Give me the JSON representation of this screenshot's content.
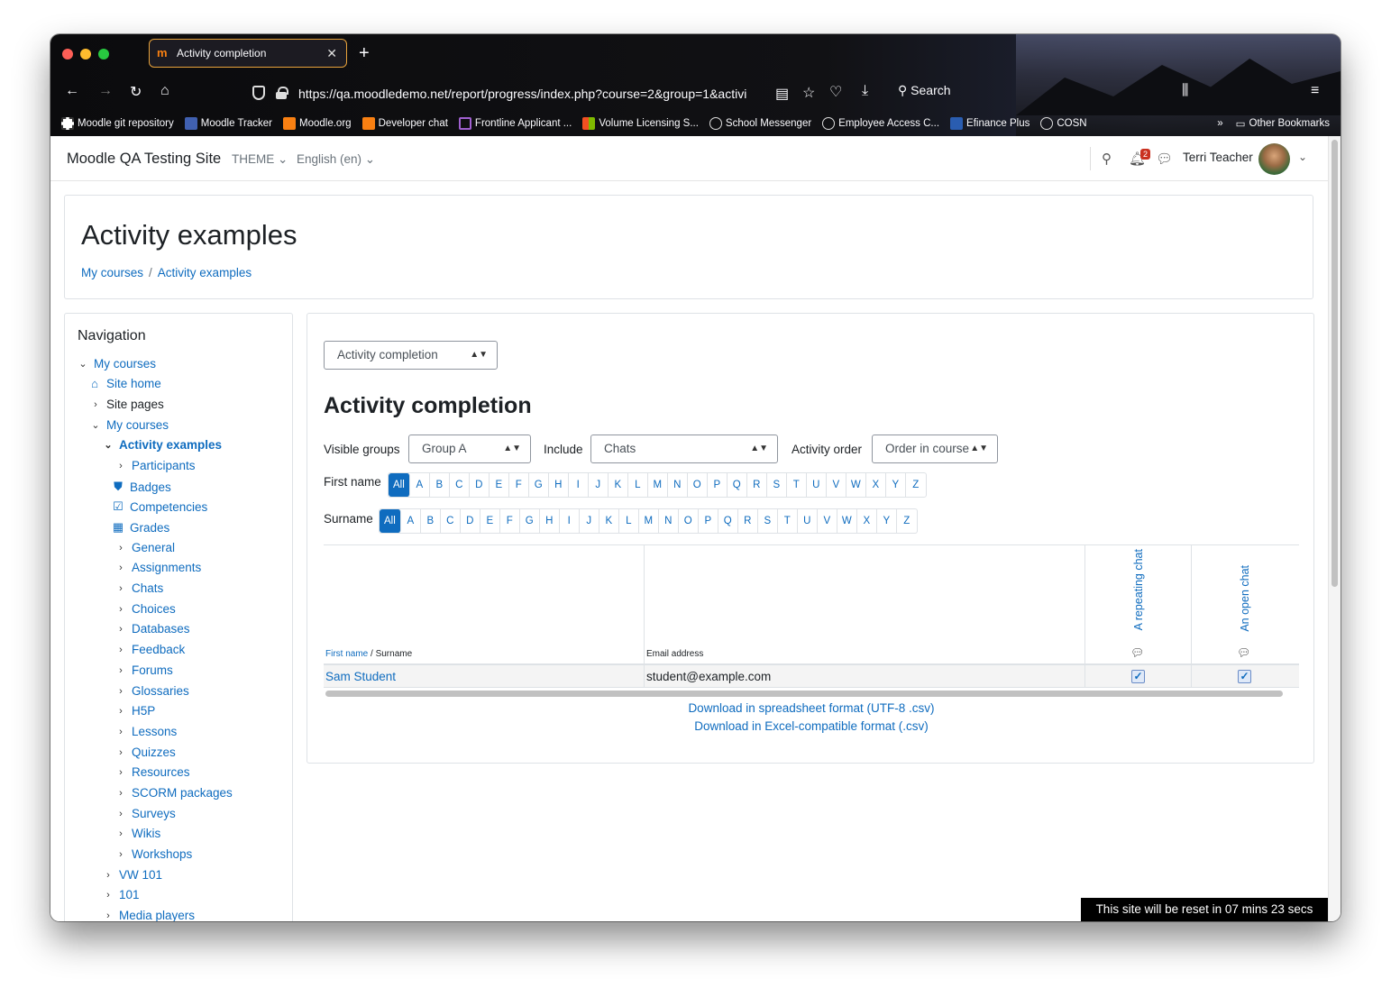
{
  "browser": {
    "tab_title": "Activity completion",
    "url": "https://qa.moodledemo.net/report/progress/index.php?course=2&group=1&activi",
    "search_label": "Search",
    "bookmarks": [
      "Moodle git repository",
      "Moodle Tracker",
      "Moodle.org",
      "Developer chat",
      "Frontline Applicant ...",
      "Volume Licensing S...",
      "School Messenger",
      "Employee Access C...",
      "Efinance Plus",
      "COSN"
    ],
    "other_bookmarks": "Other Bookmarks"
  },
  "topnav": {
    "site_title": "Moodle QA Testing Site",
    "theme": "THEME",
    "language": "English (en)",
    "notification_count": "2",
    "username": "Terri Teacher"
  },
  "header": {
    "title": "Activity examples",
    "breadcrumbs": [
      "My courses",
      "Activity examples"
    ]
  },
  "navigation": {
    "title": "Navigation",
    "items": [
      "My courses",
      "Site home",
      "Site pages",
      "My courses",
      "Activity examples",
      "Participants",
      "Badges",
      "Competencies",
      "Grades",
      "General",
      "Assignments",
      "Chats",
      "Choices",
      "Databases",
      "Feedback",
      "Forums",
      "Glossaries",
      "H5P",
      "Lessons",
      "Quizzes",
      "Resources",
      "SCORM packages",
      "Surveys",
      "Wikis",
      "Workshops",
      "VW 101",
      "101",
      "Media players"
    ]
  },
  "main": {
    "report_select": "Activity completion",
    "heading": "Activity completion",
    "visible_groups_label": "Visible groups",
    "visible_groups_value": "Group A",
    "include_label": "Include",
    "include_value": "Chats",
    "activity_order_label": "Activity order",
    "activity_order_value": "Order in course",
    "firstname_label": "First name",
    "surname_label": "Surname",
    "letters": [
      "All",
      "A",
      "B",
      "C",
      "D",
      "E",
      "F",
      "G",
      "H",
      "I",
      "J",
      "K",
      "L",
      "M",
      "N",
      "O",
      "P",
      "Q",
      "R",
      "S",
      "T",
      "U",
      "V",
      "W",
      "X",
      "Y",
      "Z"
    ],
    "table": {
      "col_firstname": "First name",
      "col_surname": "/ Surname",
      "col_email": "Email address",
      "activities": [
        "A repeating chat",
        "An open chat"
      ],
      "rows": [
        {
          "name": "Sam Student",
          "email": "student@example.com"
        }
      ]
    },
    "download_csv": "Download in spreadsheet format (UTF-8 .csv)",
    "download_excel": "Download in Excel-compatible format (.csv)"
  },
  "reset_notice": "This site will be reset in 07 mins 23 secs"
}
